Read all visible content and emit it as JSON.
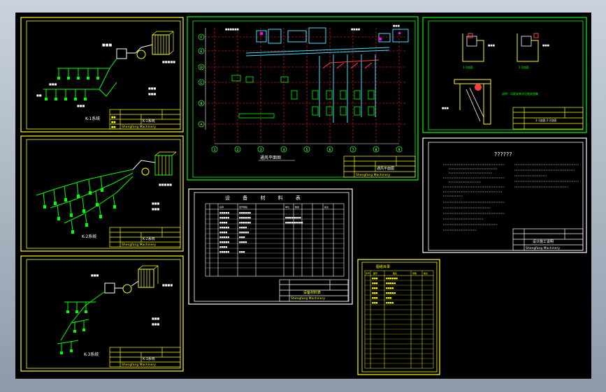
{
  "viewport": {
    "background": "#000000",
    "sheet_colors": {
      "frame": "#ffff00",
      "lines": "#00ff00",
      "text": "#ffffff",
      "grid": "#ff2020",
      "ducts": "#40e0ff"
    }
  },
  "sheets": {
    "iso1": {
      "caption": "K-1系统",
      "title_block": {
        "drawing_name": "K-1系统",
        "company": "Shengfang Machinery"
      },
      "tags": [
        "出图",
        "审核",
        "设计"
      ]
    },
    "iso2": {
      "caption": "K-2系统",
      "title_block": {
        "drawing_name": "K-2系统",
        "company": "Shengfang Machinery"
      }
    },
    "iso3": {
      "caption": "K-3系统",
      "title_block": {
        "drawing_name": "K-3系统",
        "company": "Shengfang Machinery"
      }
    },
    "plan": {
      "caption": "通风平面图",
      "axis_numbers": [
        "1",
        "2",
        "3",
        "4",
        "5",
        "6",
        "7",
        "8",
        "9"
      ],
      "axis_letters": [
        "A",
        "B",
        "C",
        "D",
        "E",
        "F"
      ],
      "title_block": {
        "drawing_name": "通风平面图",
        "company": "Shengfang Machinery"
      }
    },
    "equipment": {
      "title": "设 备 材 料 表",
      "header": [
        "序号",
        "名称",
        "型号规格",
        "单位",
        "数量",
        "备注"
      ],
      "title_block": {
        "drawing_name": "设备材料表",
        "company": "Shengfang Machinery"
      }
    },
    "detail": {
      "labels": [
        "1-1剖面",
        "2-2剖面"
      ],
      "note": "说明：风管安装详见相关图集",
      "title_block": {
        "drawing_name": "1-1剖面 2-2剖面"
      }
    },
    "notes": {
      "title": "??????",
      "title_block": {
        "drawing_name": "设计施工说明",
        "company": "Shengfang Machinery"
      }
    },
    "index": {
      "title": "图纸目录",
      "header": [
        "序号",
        "图号",
        "图名",
        "张数",
        "备注"
      ]
    }
  }
}
